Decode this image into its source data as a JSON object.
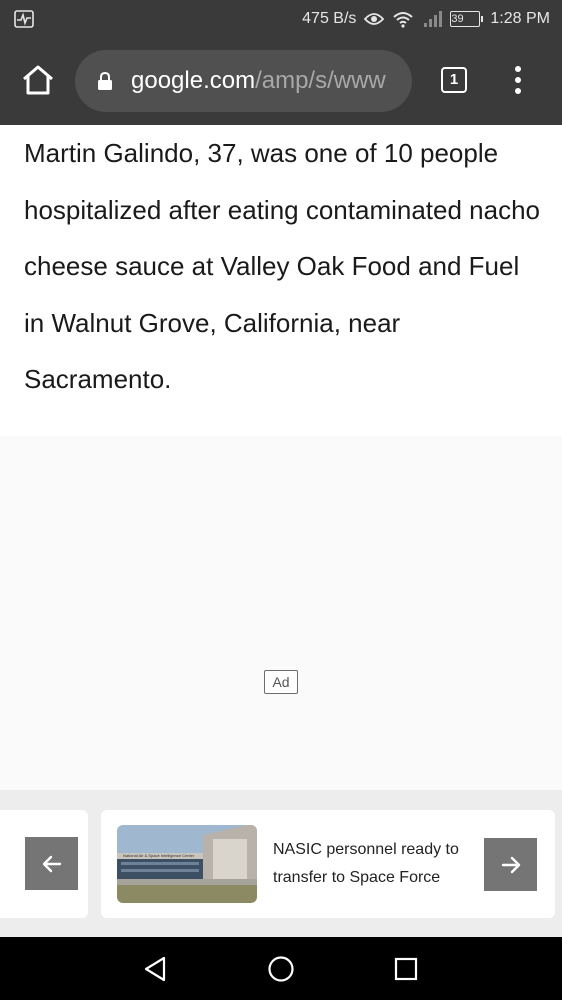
{
  "status_bar": {
    "network_speed": "475 B/s",
    "battery": "39",
    "time": "1:28 PM",
    "icons": [
      "activity-icon",
      "eye-icon",
      "wifi-icon",
      "signal-icon",
      "battery-icon"
    ]
  },
  "browser": {
    "url_host": "google.com",
    "url_rest": "/amp/s/www",
    "tab_count": "1",
    "icons": [
      "home-icon",
      "lock-icon",
      "tabs-icon",
      "more-vert-icon"
    ]
  },
  "article": {
    "paragraph": "Martin Galindo, 37, was one of 10 people hospitalized after eating contaminated nacho cheese sauce at Valley Oak Food and Fuel in Walnut Grove, California, near Sacramento."
  },
  "ad": {
    "badge": "Ad"
  },
  "related": {
    "title": "NASIC personnel ready to transfer to Space Force",
    "thumbnail_sign": "National Air & Space Intelligence Center",
    "icons": [
      "arrow-left-icon",
      "arrow-right-icon"
    ]
  },
  "system_nav": {
    "icons": [
      "back-icon",
      "home-circle-icon",
      "recents-icon"
    ]
  },
  "colors": {
    "chrome_bar": "#3a3a3a",
    "url_pill": "#505050",
    "arrow_button": "#757575",
    "strip": "#ededed"
  }
}
